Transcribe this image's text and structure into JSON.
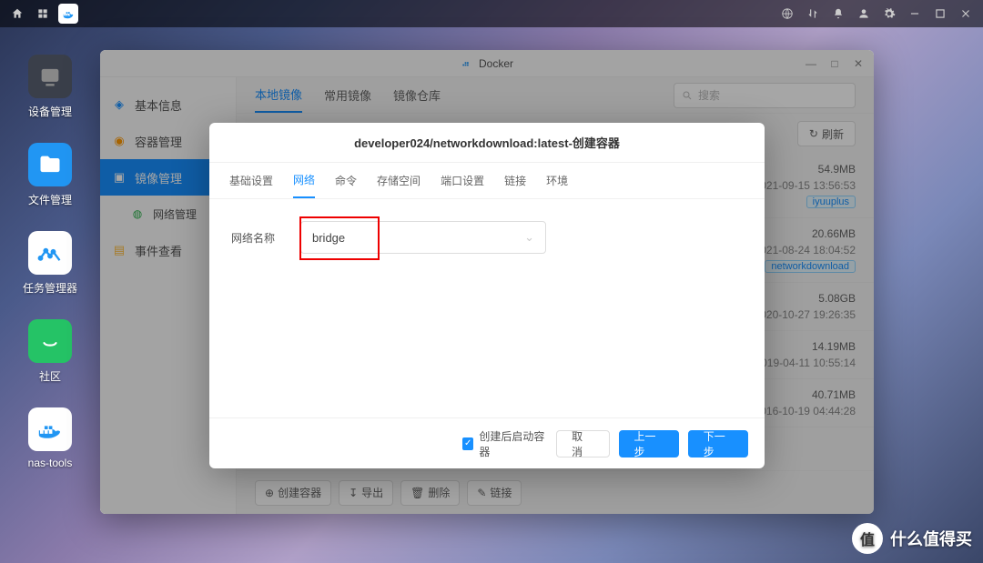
{
  "taskbar": {},
  "desktop": [
    {
      "label": "设备管理",
      "color": "#3a3f4a"
    },
    {
      "label": "文件管理",
      "color": "#2196f3"
    },
    {
      "label": "任务管理器",
      "color": "#ffffff"
    },
    {
      "label": "社区",
      "color": "#25c366"
    },
    {
      "label": "nas-tools",
      "color": "#ffffff"
    }
  ],
  "window": {
    "title": "Docker",
    "sidebar": [
      {
        "label": "基本信息",
        "icon": "info",
        "color": "#1890ff"
      },
      {
        "label": "容器管理",
        "icon": "cube",
        "color": "#ff9800"
      },
      {
        "label": "镜像管理",
        "icon": "layers",
        "active": true
      },
      {
        "label": "网络管理",
        "icon": "net",
        "sub": true,
        "color": "#2bb24c"
      },
      {
        "label": "事件查看",
        "icon": "event",
        "sub": false,
        "color": "#ffbe3d"
      }
    ],
    "tabs": [
      {
        "label": "本地镜像",
        "active": true
      },
      {
        "label": "常用镜像"
      },
      {
        "label": "镜像仓库"
      }
    ],
    "search_placeholder": "搜索",
    "refresh": "刷新",
    "rows": [
      {
        "size": "54.9MB",
        "date": "2021-09-15 13:56:53",
        "tag": "iyuuplus"
      },
      {
        "size": "20.66MB",
        "date": "2021-08-24 18:04:52",
        "tag": "networkdownload"
      },
      {
        "size": "5.08GB",
        "date": "2020-10-27 19:26:35"
      },
      {
        "size": "14.19MB",
        "date": "2019-04-11 10:55:14"
      },
      {
        "size": "40.71MB",
        "date": "2016-10-19 04:44:28"
      }
    ],
    "bottom": [
      {
        "label": "创建容器",
        "icon": "⊕"
      },
      {
        "label": "导出",
        "icon": "↧"
      },
      {
        "label": "删除",
        "icon": "🗑"
      },
      {
        "label": "链接",
        "icon": "✎"
      }
    ]
  },
  "modal": {
    "title": "developer024/networkdownload:latest-创建容器",
    "tabs": [
      {
        "label": "基础设置"
      },
      {
        "label": "网络",
        "active": true
      },
      {
        "label": "命令"
      },
      {
        "label": "存储空间"
      },
      {
        "label": "端口设置"
      },
      {
        "label": "链接"
      },
      {
        "label": "环境"
      }
    ],
    "form": {
      "label": "网络名称",
      "value": "bridge"
    },
    "checkbox": "创建后启动容器",
    "buttons": {
      "cancel": "取 消",
      "prev": "上一步",
      "next": "下一步"
    }
  },
  "watermark": "什么值得买"
}
